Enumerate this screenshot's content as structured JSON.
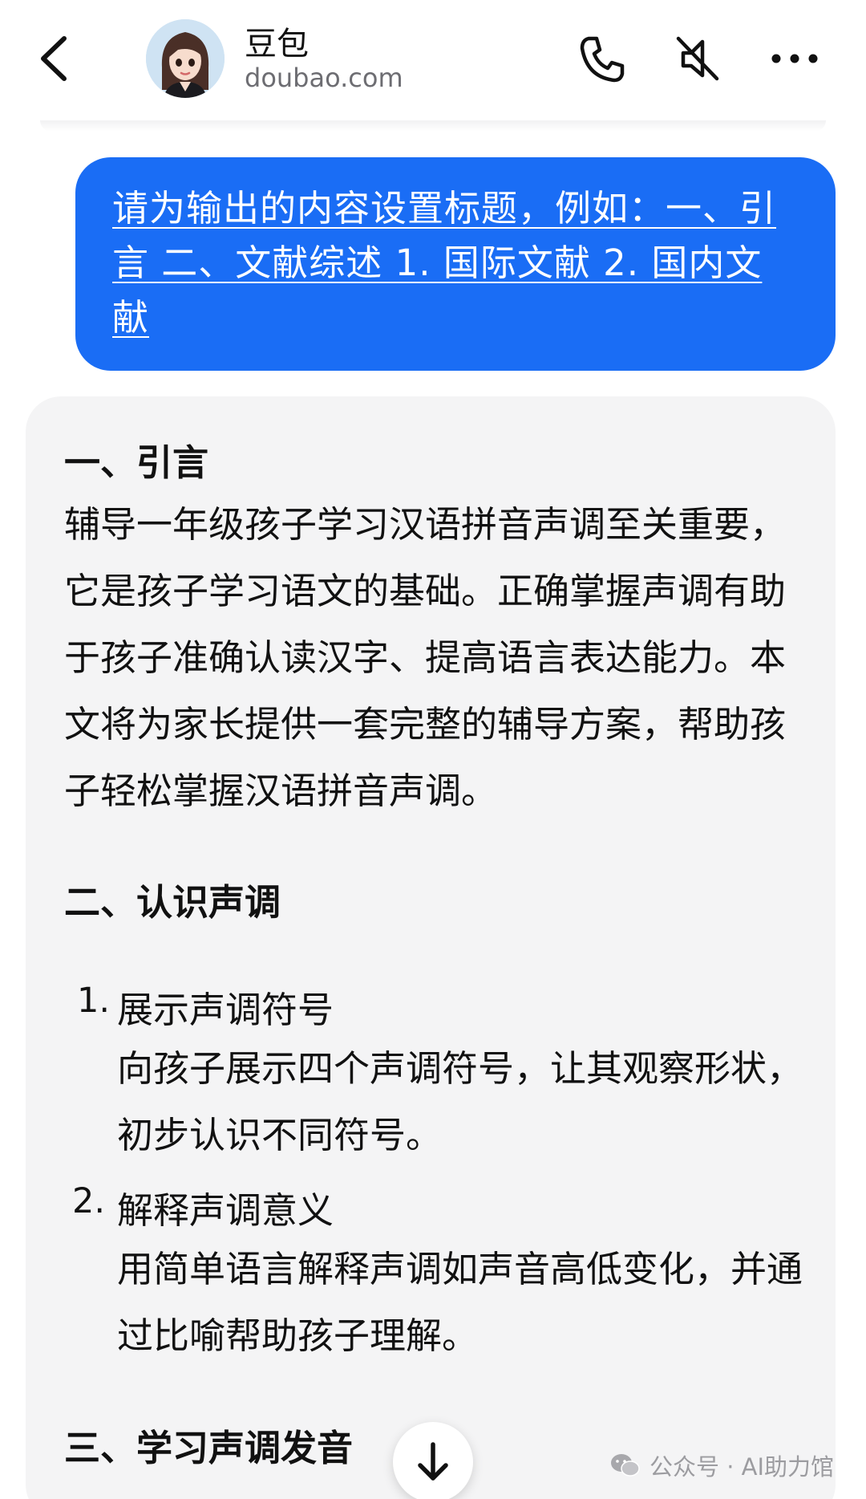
{
  "header": {
    "title": "豆包",
    "subtitle": "doubao.com",
    "icons": [
      "back-icon",
      "avatar",
      "phone-icon",
      "speaker-mute-icon",
      "more-icon"
    ]
  },
  "user_message": {
    "text": "请为输出的内容设置标题，例如：一、引言  二、文献综述  1. 国际文献  2. 国内文献"
  },
  "ai_message": {
    "section1_heading": "一、引言",
    "section1_body": "辅导一年级孩子学习汉语拼音声调至关重要，它是孩子学习语文的基础。正确掌握声调有助于孩子准确认读汉字、提高语言表达能力。本文将为家长提供一套完整的辅导方案，帮助孩子轻松掌握汉语拼音声调。",
    "section2_heading": "二、认识声调",
    "items": [
      {
        "num": "1.",
        "title": "展示声调符号",
        "body": "向孩子展示四个声调符号，让其观察形状，初步认识不同符号。"
      },
      {
        "num": "2.",
        "title": "解释声调意义",
        "body": "用简单语言解释声调如声音高低变化，并通过比喻帮助孩子理解。"
      }
    ],
    "section3_heading": "三、学习声调发音"
  },
  "watermark": {
    "text": "公众号 · AI助力馆"
  },
  "colors": {
    "user_bubble": "#1a6df5",
    "ai_bubble": "#f4f4f5",
    "subtitle": "#6d6d72"
  }
}
